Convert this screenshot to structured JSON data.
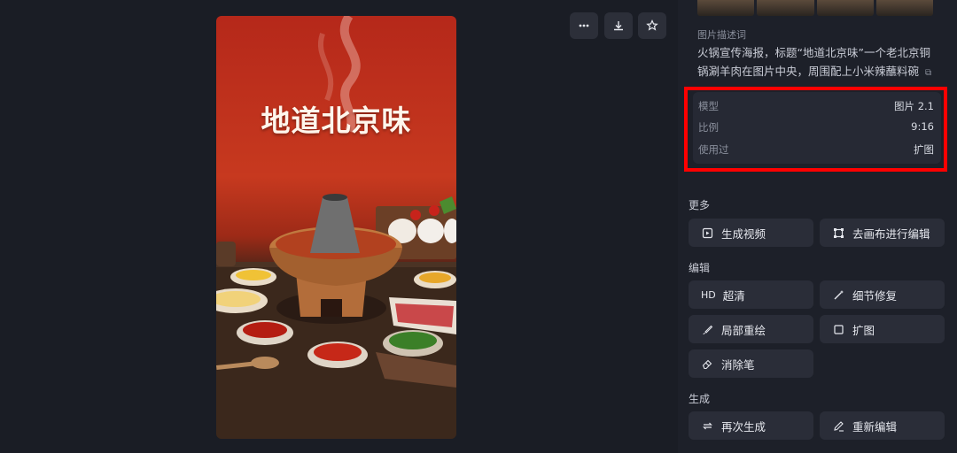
{
  "toolbar": {
    "more_icon": "more-horizontal-icon",
    "download_icon": "download-icon",
    "favorite_icon": "star-icon"
  },
  "poster": {
    "title": "地道北京味"
  },
  "description": {
    "label": "图片描述词",
    "text": "火锅宣传海报，标题“地道北京味”一个老北京铜锅涮羊肉在图片中央，周围配上小米辣蘸料碗"
  },
  "meta": {
    "rows": [
      {
        "key": "模型",
        "value": "图片 2.1"
      },
      {
        "key": "比例",
        "value": "9:16"
      },
      {
        "key": "使用过",
        "value": "扩图"
      }
    ]
  },
  "sections": {
    "more": "更多",
    "edit": "编辑",
    "generate": "生成"
  },
  "buttons": {
    "generate_video": "生成视频",
    "canvas_edit": "去画布进行编辑",
    "hd_prefix": "HD",
    "hd": "超清",
    "detail_fix": "细节修复",
    "local_redraw": "局部重绘",
    "expand": "扩图",
    "eraser": "消除笔",
    "regenerate": "再次生成",
    "re_edit": "重新编辑"
  },
  "colors": {
    "highlight": "#ff0000",
    "background": "#1d2029",
    "button": "#2a2d38"
  }
}
